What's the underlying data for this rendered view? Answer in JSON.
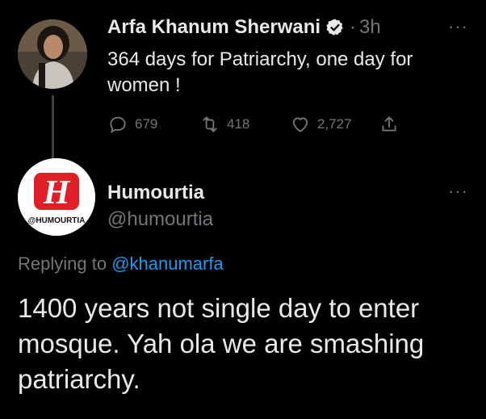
{
  "parent_tweet": {
    "author_name": "Arfa Khanum Sherwani",
    "separator": "·",
    "time": "3h",
    "text": "364 days for Patriarchy, one day for women !",
    "stats": {
      "replies": "679",
      "retweets": "418",
      "likes": "2,727"
    },
    "more": "···"
  },
  "reply_tweet": {
    "author_name": "Humourtia",
    "handle": "@humourtia",
    "avatar_letter": "H",
    "avatar_caption": "@HUMOURTIA",
    "replying_prefix": "Replying to",
    "replying_handle": "@khanumarfa",
    "text": "1400 years not single day to enter mosque. Yah ola we are smashing patriarchy.",
    "more": "···"
  },
  "colors": {
    "background": "#000000",
    "text": "#e7e9ea",
    "muted": "#71767b",
    "link": "#1d9bf0",
    "brand_red": "#e01e26"
  }
}
